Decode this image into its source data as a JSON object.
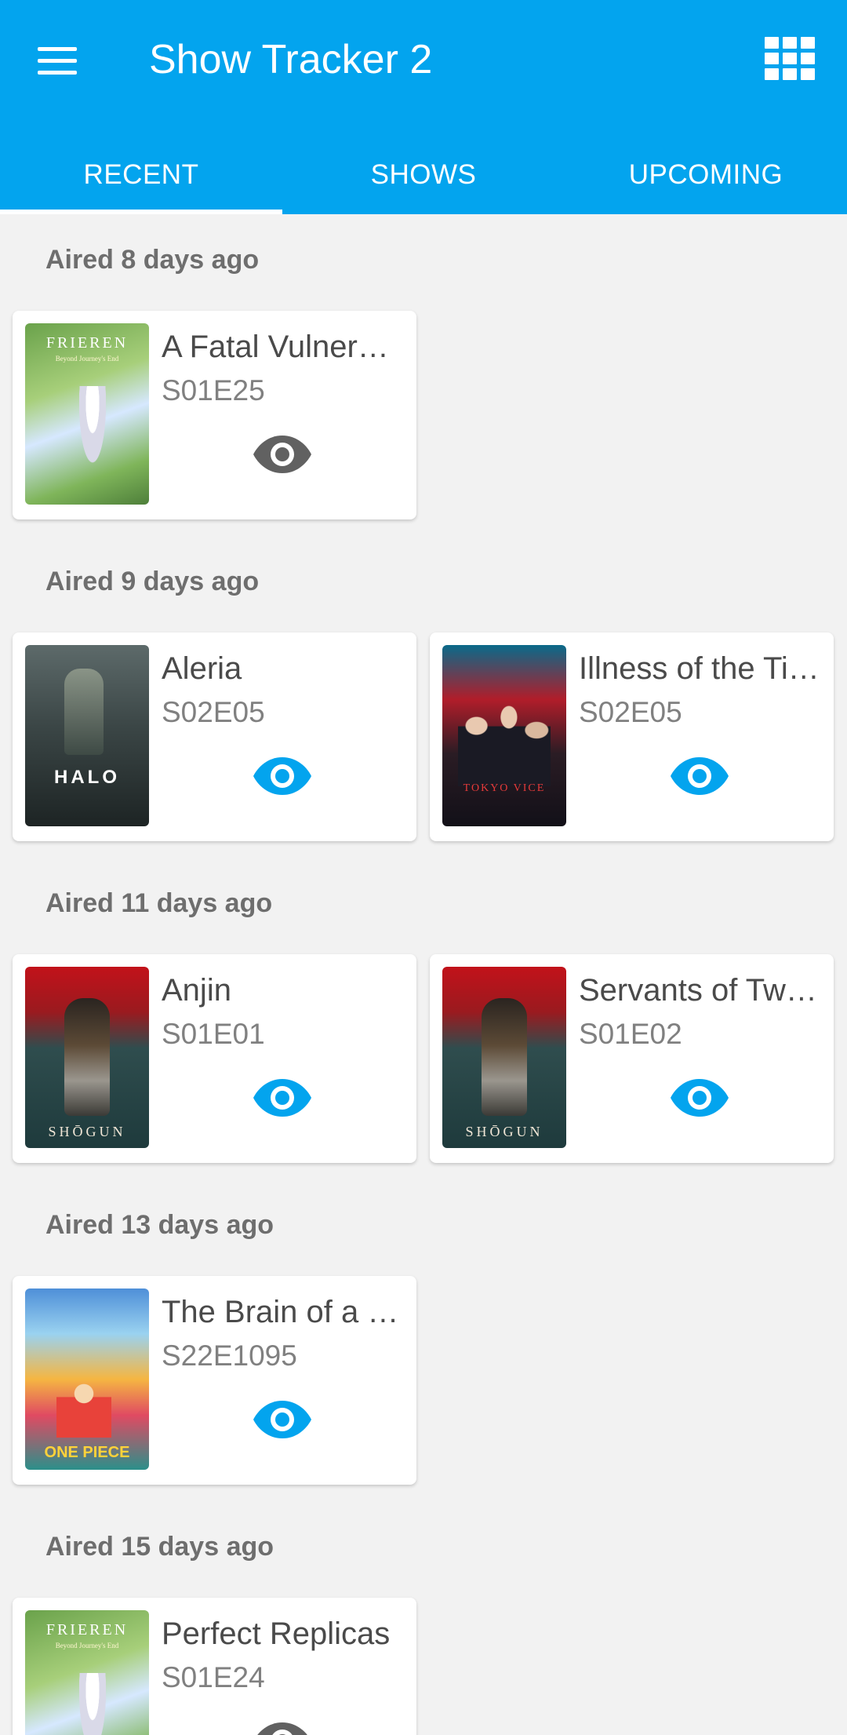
{
  "app": {
    "title": "Show Tracker 2",
    "accent": "#03a4ee"
  },
  "icons": {
    "menu": "hamburger-menu-icon",
    "view": "grid-view-icon",
    "watch": "eye-icon"
  },
  "tabs": [
    {
      "label": "RECENT",
      "active": true
    },
    {
      "label": "SHOWS",
      "active": false
    },
    {
      "label": "UPCOMING",
      "active": false
    }
  ],
  "sections": [
    {
      "header": "Aired 8 days ago",
      "episodes": [
        {
          "title": "A Fatal Vulnerability",
          "code": "S01E25",
          "show": "FRIEREN",
          "poster_subtitle": "Beyond Journey's End",
          "watched": true
        }
      ]
    },
    {
      "header": "Aired 9 days ago",
      "episodes": [
        {
          "title": "Aleria",
          "code": "S02E05",
          "show": "HALO",
          "watched": false
        },
        {
          "title": "Illness of the Times",
          "code": "S02E05",
          "show": "TOKYO VICE",
          "watched": false
        }
      ]
    },
    {
      "header": "Aired 11 days ago",
      "episodes": [
        {
          "title": "Anjin",
          "code": "S01E01",
          "show": "SHŌGUN",
          "watched": false
        },
        {
          "title": "Servants of Two Masters",
          "code": "S01E02",
          "show": "SHŌGUN",
          "watched": false
        }
      ]
    },
    {
      "header": "Aired 13 days ago",
      "episodes": [
        {
          "title": "The Brain of a Genius",
          "code": "S22E1095",
          "show": "ONE PIECE",
          "watched": false
        }
      ]
    },
    {
      "header": "Aired 15 days ago",
      "episodes": [
        {
          "title": "Perfect Replicas",
          "code": "S01E24",
          "show": "FRIEREN",
          "poster_subtitle": "Beyond Journey's End",
          "watched": false
        }
      ]
    }
  ],
  "colors": {
    "watched_icon": "#616161",
    "unwatched_icon": "#03a4ee"
  }
}
